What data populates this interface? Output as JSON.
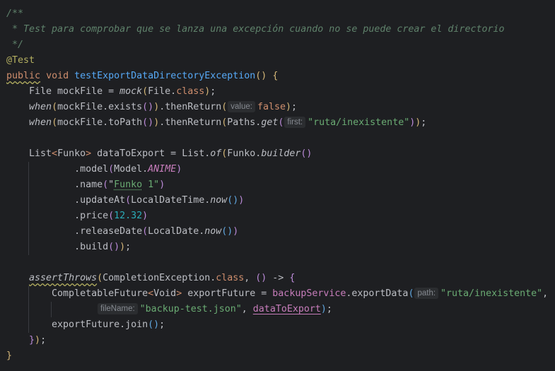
{
  "editor": {
    "language": "java",
    "lines": [
      {
        "tokens": [
          {
            "t": "/**",
            "c": "doc"
          }
        ]
      },
      {
        "tokens": [
          {
            "t": " * Test para comprobar que se lanza una excepción cuando no se puede crear el directorio",
            "c": "doc"
          }
        ]
      },
      {
        "tokens": [
          {
            "t": " */",
            "c": "doc"
          }
        ]
      },
      {
        "tokens": [
          {
            "t": "@Test",
            "c": "ann"
          }
        ]
      },
      {
        "tokens": [
          {
            "t": "public",
            "c": "kw sq"
          },
          {
            "t": " "
          },
          {
            "t": "void",
            "c": "kw"
          },
          {
            "t": " "
          },
          {
            "t": "testExportDataDirectoryException",
            "c": "fn"
          },
          {
            "t": "() {",
            "c": "p1"
          }
        ]
      },
      {
        "tokens": [
          {
            "t": "    File mockFile = "
          },
          {
            "t": "mock",
            "c": "ital"
          },
          {
            "t": "(",
            "c": "p1"
          },
          {
            "t": "File."
          },
          {
            "t": "class",
            "c": "kw"
          },
          {
            "t": ")",
            "c": "p1"
          },
          {
            "t": ";"
          }
        ]
      },
      {
        "tokens": [
          {
            "t": "    "
          },
          {
            "t": "when",
            "c": "ital"
          },
          {
            "t": "(",
            "c": "p1"
          },
          {
            "t": "mockFile.exists"
          },
          {
            "t": "()",
            "c": "p2"
          },
          {
            "t": ")",
            "c": "p1"
          },
          {
            "t": ".thenReturn"
          },
          {
            "t": "(",
            "c": "p1"
          },
          {
            "t": "value:",
            "c": "hint"
          },
          {
            "t": "false",
            "c": "kw"
          },
          {
            "t": ")",
            "c": "p1"
          },
          {
            "t": ";"
          }
        ]
      },
      {
        "tokens": [
          {
            "t": "    "
          },
          {
            "t": "when",
            "c": "ital"
          },
          {
            "t": "(",
            "c": "p1"
          },
          {
            "t": "mockFile.toPath"
          },
          {
            "t": "()",
            "c": "p2"
          },
          {
            "t": ")",
            "c": "p1"
          },
          {
            "t": ".thenReturn"
          },
          {
            "t": "(",
            "c": "p1"
          },
          {
            "t": "Paths."
          },
          {
            "t": "get",
            "c": "ital"
          },
          {
            "t": "(",
            "c": "p2"
          },
          {
            "t": "first:",
            "c": "hint"
          },
          {
            "t": "\"ruta/inexistente\"",
            "c": "str"
          },
          {
            "t": ")",
            "c": "p2"
          },
          {
            "t": ")",
            "c": "p1"
          },
          {
            "t": ";"
          }
        ]
      },
      {
        "tokens": []
      },
      {
        "tokens": [
          {
            "t": "    List"
          },
          {
            "t": "<",
            "c": "kw"
          },
          {
            "t": "Funko"
          },
          {
            "t": ">",
            "c": "kw"
          },
          {
            "t": " dataToExport = List."
          },
          {
            "t": "of",
            "c": "ital"
          },
          {
            "t": "(",
            "c": "p1"
          },
          {
            "t": "Funko."
          },
          {
            "t": "builder",
            "c": "ital"
          },
          {
            "t": "()",
            "c": "p2"
          }
        ]
      },
      {
        "tokens": [
          {
            "t": "            .model"
          },
          {
            "t": "(",
            "c": "p2"
          },
          {
            "t": "Model."
          },
          {
            "t": "ANIME",
            "c": "const"
          },
          {
            "t": ")",
            "c": "p2"
          }
        ]
      },
      {
        "tokens": [
          {
            "t": "            .name"
          },
          {
            "t": "(",
            "c": "p2"
          },
          {
            "t": "\""
          },
          {
            "t": "Funko",
            "c": "str typo"
          },
          {
            "t": " 1\"",
            "c": "str"
          },
          {
            "t": ")",
            "c": "p2"
          }
        ]
      },
      {
        "tokens": [
          {
            "t": "            .updateAt"
          },
          {
            "t": "(",
            "c": "p2"
          },
          {
            "t": "LocalDateTime."
          },
          {
            "t": "now",
            "c": "ital"
          },
          {
            "t": "()",
            "c": "p3"
          },
          {
            "t": ")",
            "c": "p2"
          }
        ]
      },
      {
        "tokens": [
          {
            "t": "            .price"
          },
          {
            "t": "(",
            "c": "p2"
          },
          {
            "t": "12.32",
            "c": "num"
          },
          {
            "t": ")",
            "c": "p2"
          }
        ]
      },
      {
        "tokens": [
          {
            "t": "            .releaseDate"
          },
          {
            "t": "(",
            "c": "p2"
          },
          {
            "t": "LocalDate."
          },
          {
            "t": "now",
            "c": "ital"
          },
          {
            "t": "()",
            "c": "p3"
          },
          {
            "t": ")",
            "c": "p2"
          }
        ]
      },
      {
        "tokens": [
          {
            "t": "            .build"
          },
          {
            "t": "()",
            "c": "p2"
          },
          {
            "t": ")",
            "c": "p1"
          },
          {
            "t": ";"
          }
        ]
      },
      {
        "tokens": []
      },
      {
        "tokens": [
          {
            "t": "    "
          },
          {
            "t": "assertThrows",
            "c": "ital sq"
          },
          {
            "t": "(",
            "c": "p1"
          },
          {
            "t": "CompletionException."
          },
          {
            "t": "class",
            "c": "kw"
          },
          {
            "t": ", "
          },
          {
            "t": "()",
            "c": "p2"
          },
          {
            "t": " -> "
          },
          {
            "t": "{",
            "c": "p2"
          }
        ]
      },
      {
        "tokens": [
          {
            "t": "        CompletableFuture"
          },
          {
            "t": "<",
            "c": "kw"
          },
          {
            "t": "Void"
          },
          {
            "t": ">",
            "c": "kw"
          },
          {
            "t": " exportFuture = "
          },
          {
            "t": "backupService",
            "c": "fld"
          },
          {
            "t": ".exportData"
          },
          {
            "t": "(",
            "c": "p3"
          },
          {
            "t": "path:",
            "c": "hint"
          },
          {
            "t": "\"ruta/inexistente\"",
            "c": "str"
          },
          {
            "t": ","
          }
        ]
      },
      {
        "tokens": [
          {
            "t": "                "
          },
          {
            "t": "fileName:",
            "c": "hint"
          },
          {
            "t": "\"backup-test.json\"",
            "c": "str"
          },
          {
            "t": ", "
          },
          {
            "t": "dataToExport",
            "c": "fld ul"
          },
          {
            "t": ")",
            "c": "p3"
          },
          {
            "t": ";"
          }
        ]
      },
      {
        "tokens": [
          {
            "t": "        exportFuture.join"
          },
          {
            "t": "()",
            "c": "p3"
          },
          {
            "t": ";"
          }
        ]
      },
      {
        "tokens": [
          {
            "t": "    "
          },
          {
            "t": "}",
            "c": "p2"
          },
          {
            "t": ")",
            "c": "p1"
          },
          {
            "t": ";"
          }
        ]
      },
      {
        "tokens": [
          {
            "t": "}",
            "c": "p1"
          }
        ]
      }
    ]
  }
}
